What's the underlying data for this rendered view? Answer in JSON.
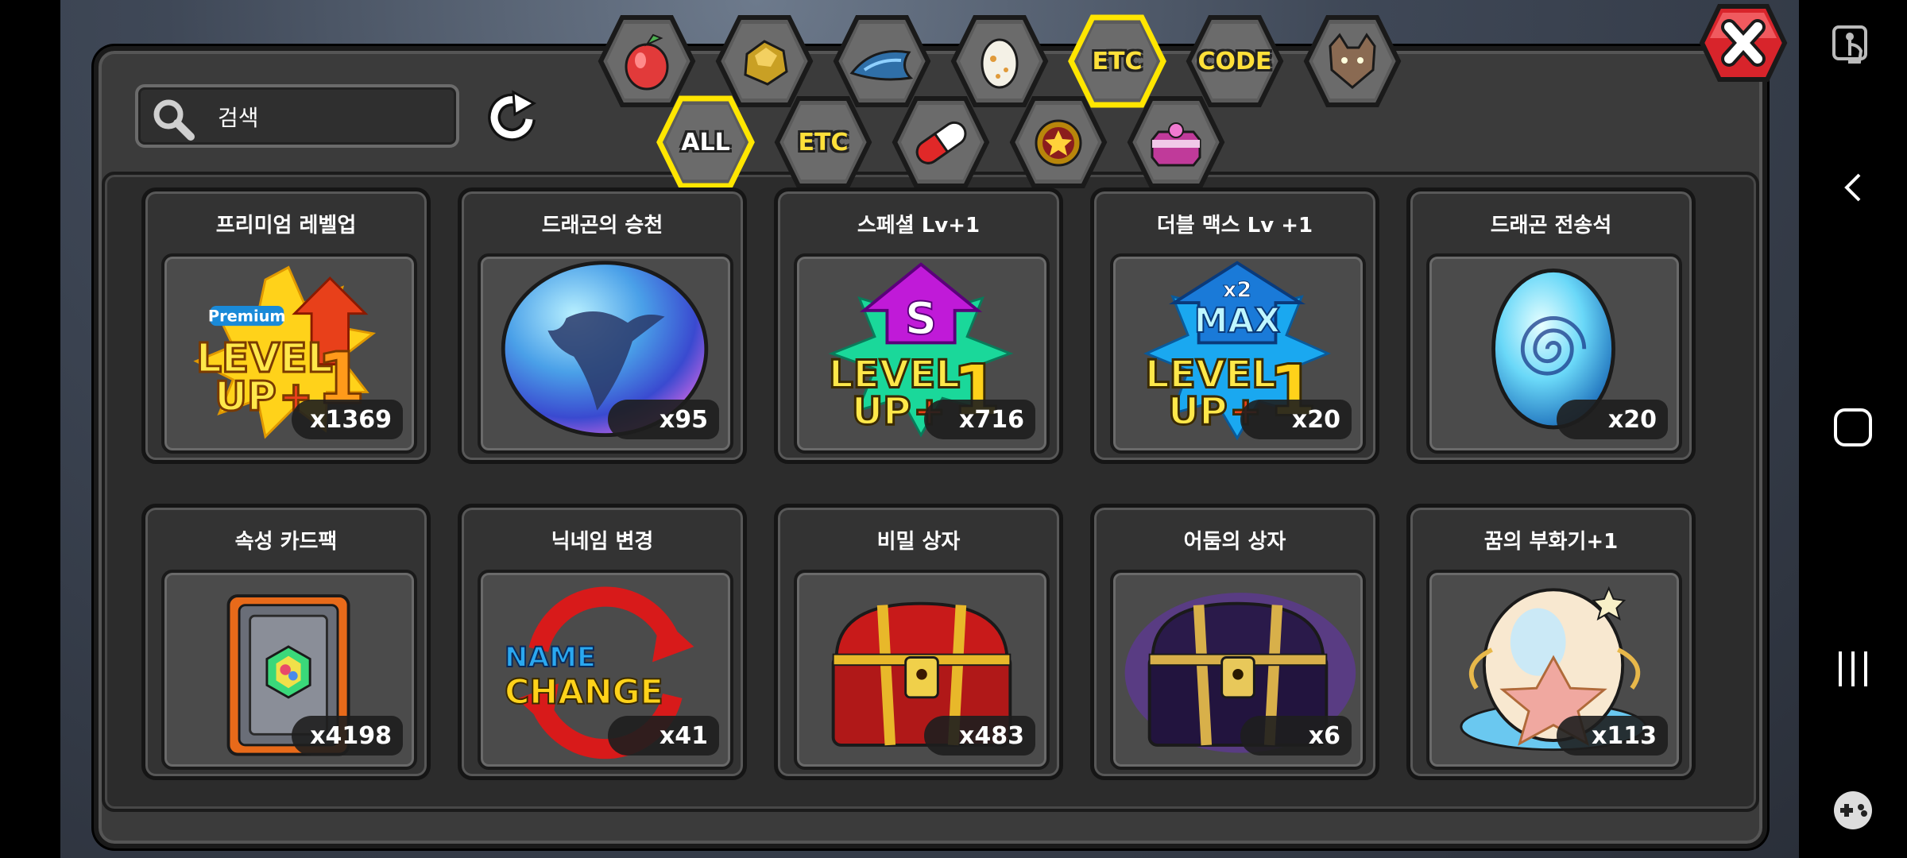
{
  "search": {
    "placeholder": "검색"
  },
  "tabs_top": [
    {
      "icon": "fruit-icon",
      "label": ""
    },
    {
      "icon": "gold-ore-icon",
      "label": ""
    },
    {
      "icon": "dragon-scale-icon",
      "label": ""
    },
    {
      "icon": "egg-icon",
      "label": ""
    },
    {
      "icon": "",
      "label": "ETC",
      "selected": true
    },
    {
      "icon": "",
      "label": "CODE"
    },
    {
      "icon": "wolf-head-icon",
      "label": ""
    }
  ],
  "tabs_sub": [
    {
      "icon": "",
      "label": "ALL",
      "selected": true
    },
    {
      "icon": "",
      "label": "ETC"
    },
    {
      "icon": "pill-capsule-icon",
      "label": ""
    },
    {
      "icon": "star-emblem-icon",
      "label": ""
    },
    {
      "icon": "gift-box-icon",
      "label": ""
    }
  ],
  "items": [
    {
      "name": "프리미엄 레벨업",
      "qty": "x1369",
      "icon": "premium-level-up-icon"
    },
    {
      "name": "드래곤의 승천",
      "qty": "x95",
      "icon": "dragon-ascension-orb-icon"
    },
    {
      "name": "스페셜 Lv+1",
      "qty": "x716",
      "icon": "special-level-up-icon"
    },
    {
      "name": "더블 맥스 Lv +1",
      "qty": "x20",
      "icon": "double-max-level-up-icon"
    },
    {
      "name": "드래곤 전송석",
      "qty": "x20",
      "icon": "dragon-transfer-stone-icon"
    },
    {
      "name": "속성 카드팩",
      "qty": "x4198",
      "icon": "element-card-pack-icon"
    },
    {
      "name": "닉네임 변경",
      "qty": "x41",
      "icon": "name-change-icon"
    },
    {
      "name": "비밀 상자",
      "qty": "x483",
      "icon": "secret-chest-icon"
    },
    {
      "name": "어둠의 상자",
      "qty": "x6",
      "icon": "dark-chest-icon"
    },
    {
      "name": "꿈의 부화기+1",
      "qty": "x113",
      "icon": "dream-incubator-icon"
    }
  ],
  "item_art_text": {
    "premium_badge": "Premium",
    "level": "LEVEL",
    "up": "UP",
    "plus": "+",
    "one": "1",
    "s": "S",
    "x2": "x2",
    "max": "MAX",
    "name": "NAME",
    "change": "CHANGE"
  },
  "colors": {
    "selected_tab_border": "#ffe600",
    "close_red": "#e0242b",
    "panel": "#3b3b3b"
  }
}
